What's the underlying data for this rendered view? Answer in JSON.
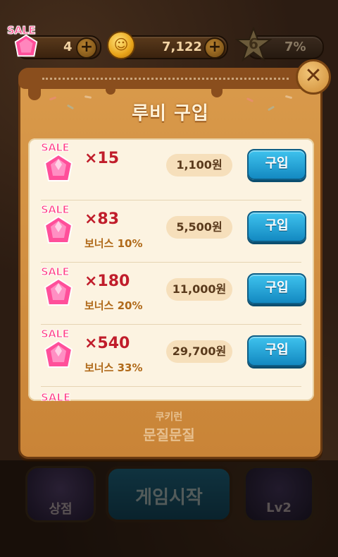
{
  "top_bar": {
    "sale_label": "SALE",
    "ruby_count": "4",
    "coin_count": "7,122",
    "level": "6",
    "level_percent": "7%",
    "plus_symbol": "+"
  },
  "dialog": {
    "title": "루비 구입",
    "close_symbol": "✕",
    "items": [
      {
        "sale": "SALE",
        "quantity": "×15",
        "bonus": "",
        "price": "1,100원",
        "buy_label": "구입"
      },
      {
        "sale": "SALE",
        "quantity": "×83",
        "bonus": "보너스 10%",
        "price": "5,500원",
        "buy_label": "구입"
      },
      {
        "sale": "SALE",
        "quantity": "×180",
        "bonus": "보너스 20%",
        "price": "11,000원",
        "buy_label": "구입"
      },
      {
        "sale": "SALE",
        "quantity": "×540",
        "bonus": "보너스 33%",
        "price": "29,700원",
        "buy_label": "구입"
      }
    ],
    "partial_sale": "SALE",
    "logo_line1": "쿠키런",
    "logo_line2": "문질문질"
  },
  "bottom_bar": {
    "shop_label": "상점",
    "start_label": "게임시작",
    "character_label": "Lv2"
  },
  "colors": {
    "ruby": "#ff4f9a",
    "buy_button": "#1f9fd6",
    "quantity": "#c01d2b"
  }
}
